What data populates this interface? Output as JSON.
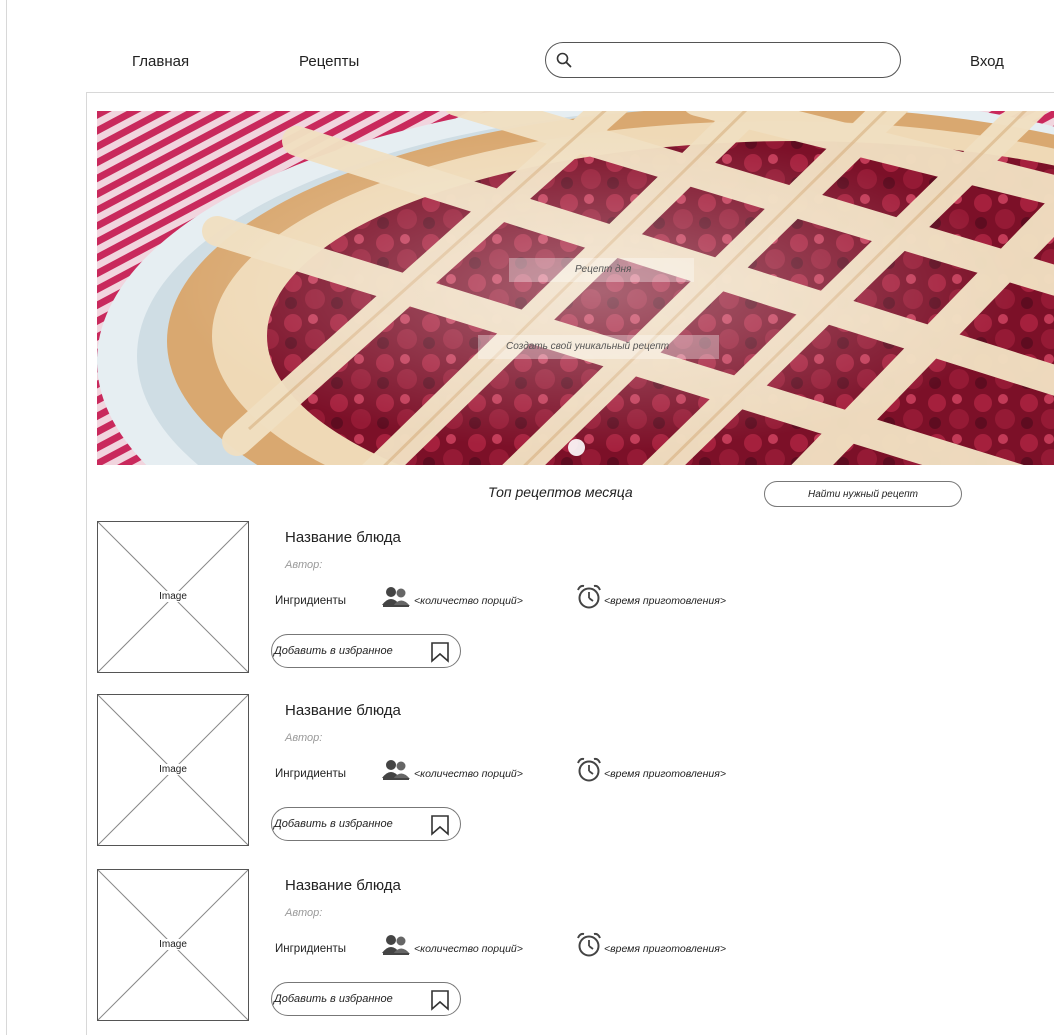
{
  "nav": {
    "home": "Главная",
    "recipes": "Рецепты",
    "login": "Вход",
    "search_placeholder": ""
  },
  "hero": {
    "caption_recipe_of_day": "Рецепт дня",
    "caption_create_recipe": "Создать свой уникальный рецепт",
    "slides_shown": 1
  },
  "top": {
    "title": "Топ рецептов месяца",
    "find_button": "Найти нужный рецепт"
  },
  "recipes": [
    {
      "image_label": "Image",
      "name": "Название блюда",
      "author": "Автор:",
      "ingredients": "Ингридиенты",
      "servings": "<количество порций>",
      "cook_time": "<время приготовления>",
      "favorite": "Добавить в избранное"
    },
    {
      "image_label": "Image",
      "name": "Название блюда",
      "author": "Автор:",
      "ingredients": "Ингридиенты",
      "servings": "<количество порций>",
      "cook_time": "<время приготовления>",
      "favorite": "Добавить в избранное"
    },
    {
      "image_label": "Image",
      "name": "Название блюда",
      "author": "Автор:",
      "ingredients": "Ингридиенты",
      "servings": "<количество порций>",
      "cook_time": "<время приготовления>",
      "favorite": "Добавить в избранное"
    }
  ],
  "icons": {
    "search": "search-icon",
    "servings": "people-icon",
    "time": "alarm-clock-icon",
    "favorite": "bookmark-icon"
  },
  "colors": {
    "tablecloth": "#c9295c",
    "crust": "#e8cba0",
    "berry": "#8e1630"
  }
}
